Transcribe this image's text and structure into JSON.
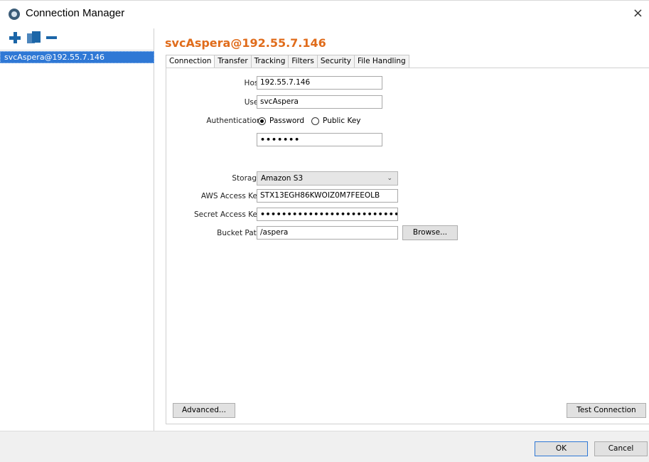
{
  "window": {
    "title": "Connection Manager",
    "close_glyph": "×",
    "icon": "aspera-app-icon"
  },
  "sidebar": {
    "tools": [
      {
        "name": "add-icon"
      },
      {
        "name": "duplicate-icon"
      },
      {
        "name": "remove-icon"
      }
    ],
    "items": [
      {
        "label": "svcAspera@192.55.7.146",
        "selected": true
      }
    ]
  },
  "main": {
    "title": "svcAspera@192.55.7.146",
    "title_color": "#e06c1b",
    "tabs": [
      {
        "label": "Connection",
        "active": true
      },
      {
        "label": "Transfer"
      },
      {
        "label": "Tracking"
      },
      {
        "label": "Filters"
      },
      {
        "label": "Security"
      },
      {
        "label": "File Handling"
      }
    ],
    "form": {
      "host_label": "Host:",
      "host_value": "192.55.7.146",
      "user_label": "User:",
      "user_value": "svcAspera",
      "auth_label": "Authentication:",
      "auth_options": [
        {
          "label": "Password",
          "selected": true
        },
        {
          "label": "Public Key",
          "selected": false
        }
      ],
      "password_value": "•••••••",
      "storage_label": "Storage:",
      "storage_value": "Amazon S3",
      "aws_key_label": "AWS Access Key:",
      "aws_key_value": "STX13EGH86KWOIZ0M7FEEOLB",
      "secret_label": "Secret Access Key:",
      "secret_value": "••••••••••••••••••••••••••••••",
      "bucket_label": "Bucket Path:",
      "bucket_value": "/aspera",
      "browse_label": "Browse..."
    },
    "advanced_label": "Advanced...",
    "test_label": "Test Connection"
  },
  "footer": {
    "ok_label": "OK",
    "cancel_label": "Cancel"
  },
  "colors": {
    "selection": "#2f78d5",
    "accent_icon": "#1c66a8"
  }
}
